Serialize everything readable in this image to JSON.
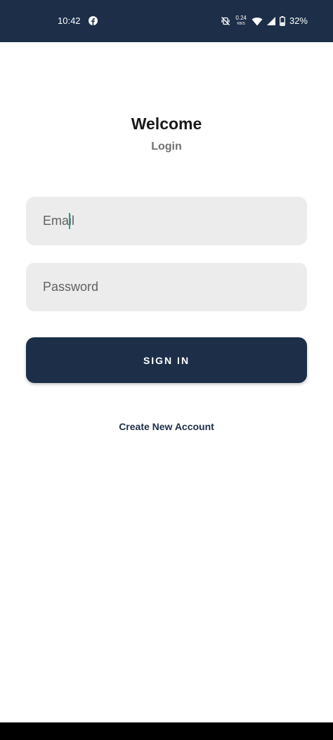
{
  "status_bar": {
    "time": "10:42",
    "net_speed_value": "0.24",
    "net_speed_unit": "KB/S",
    "battery_percent": "32%",
    "icons": [
      "facebook-icon",
      "vibrate-off-icon",
      "wifi-icon",
      "cell-signal-icon",
      "battery-icon"
    ]
  },
  "header": {
    "title": "Welcome",
    "subtitle": "Login"
  },
  "form": {
    "email_placeholder": "Email",
    "email_value": "",
    "password_placeholder": "Password",
    "password_value": "",
    "sign_in_label": "SIGN IN",
    "create_account_label": "Create New Account"
  },
  "colors": {
    "primary": "#1c2e48",
    "field_background": "#ececec",
    "caret": "#1aa39a"
  }
}
